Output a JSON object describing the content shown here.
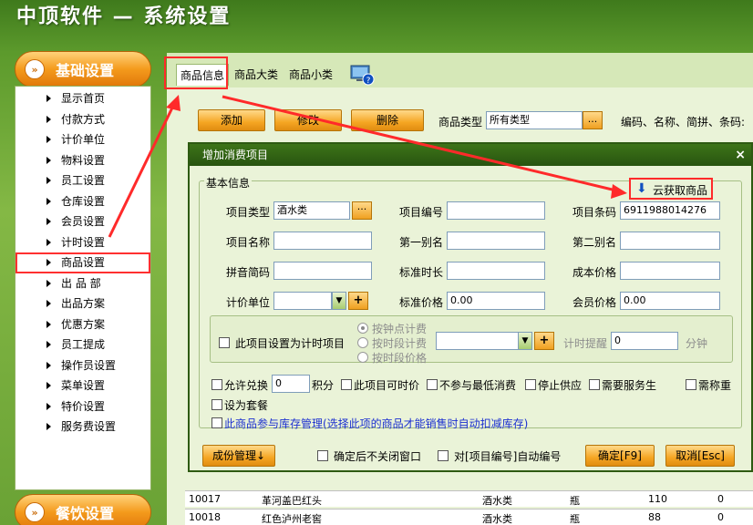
{
  "app": {
    "title": "中顶软件 — 系统设置"
  },
  "sidebar": {
    "header_top": "基础设置",
    "header_bottom": "餐饮设置",
    "items": [
      "显示首页",
      "付款方式",
      "计价单位",
      "物料设置",
      "员工设置",
      "仓库设置",
      "会员设置",
      "计时设置",
      "商品设置",
      "出 品 部",
      "出品方案",
      "优惠方案",
      "员工提成",
      "操作员设置",
      "菜单设置",
      "特价设置",
      "服务费设置"
    ]
  },
  "tabs": [
    "商品信息",
    "商品大类",
    "商品小类"
  ],
  "toolbar": {
    "add": "添加",
    "edit": "修改",
    "delete": "删除",
    "type_label": "商品类型",
    "type_value": "所有类型",
    "dots": "...",
    "search_label": "编码、名称、简拼、条码:"
  },
  "grid": {
    "rows": [
      {
        "code": "10017",
        "name": "革河盖巴红头",
        "type": "酒水类",
        "unit": "瓶",
        "qty": "110",
        "z": "0"
      },
      {
        "code": "10018",
        "name": "红色泸州老窖",
        "type": "酒水类",
        "unit": "瓶",
        "qty": "88",
        "z": "0"
      }
    ]
  },
  "dialog": {
    "title": "增加消费项目",
    "close": "×",
    "group_basic": "基本信息",
    "cloud_button": "云获取商品",
    "labels": {
      "item_type": "项目类型",
      "item_code": "项目编号",
      "barcode": "项目条码",
      "item_name": "项目名称",
      "alias1": "第一别名",
      "alias2": "第二别名",
      "pinyin": "拼音简码",
      "std_duration": "标准时长",
      "cost": "成本价格",
      "unit": "计价单位",
      "std_price": "标准价格",
      "member_price": "会员价格"
    },
    "values": {
      "item_type": "酒水类",
      "barcode": "6911988014276",
      "std_price": "0.00",
      "member_price": "0.00"
    },
    "timing": {
      "checkbox": "此项目设置为计时项目",
      "options": [
        "按钟点计费",
        "按时段计费",
        "按时段价格"
      ],
      "remind_label": "计时提醒",
      "remind_value": "0",
      "minutes": "分钟"
    },
    "flags": {
      "points": "允许兑换",
      "points_value": "0",
      "points_unit": "积分",
      "time_price": "此项目可时价",
      "no_min": "不参与最低消费",
      "stop_supply": "停止供应",
      "need_service": "需要服务生",
      "weigh": "需称重",
      "set_meal": "设为套餐",
      "inventory": "此商品参与库存管理(选择此项的商品才能销售时自动扣减库存)"
    },
    "footer": {
      "bom": "成份管理↓",
      "keep_open": "确定后不关闭窗口",
      "auto_code": "对[项目编号]自动编号",
      "ok": "确定[F9]",
      "cancel": "取消[Esc]"
    }
  }
}
